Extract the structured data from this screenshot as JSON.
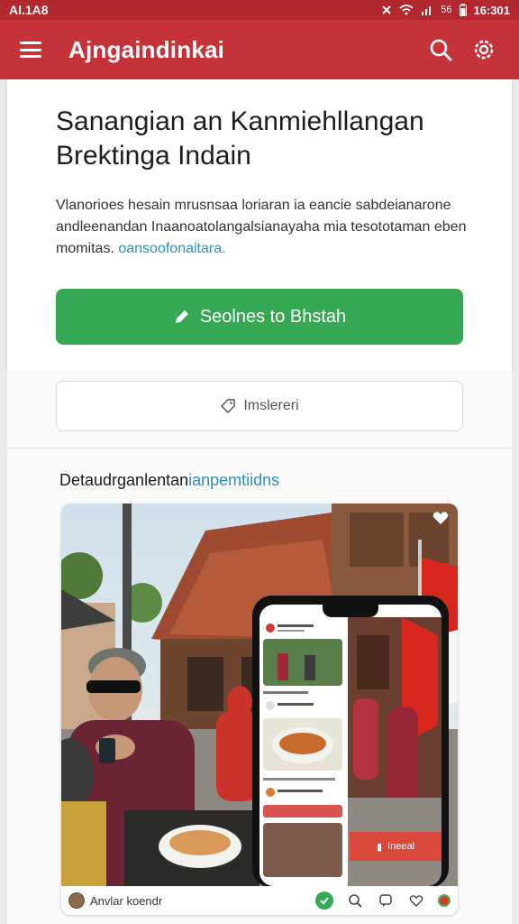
{
  "status_bar": {
    "left_text": "Al.1A8",
    "signal_text": "56",
    "time": "16:301"
  },
  "app_bar": {
    "title": "Ajngaindinkai",
    "icons": [
      "menu-icon",
      "search-icon",
      "gear-icon"
    ]
  },
  "hero": {
    "title_line1": "Sanangian an Kanmiehllangan",
    "title_line2": "Brektinga Indain",
    "description": "Vlanorioes hesain mrusnsaa loriaran ia eancie sabdeianarone andleenandan Inaanoatolangalsianayaha mia tesototaman eben momitas.",
    "description_link": "oansoofonaitara.",
    "primary_button": "Seolnes to Bhstah",
    "primary_button_icon": "pencil-icon",
    "primary_color": "#35a853"
  },
  "secondary_button": {
    "label": "Imslereri",
    "icon": "tag-icon"
  },
  "section": {
    "title_main": "Detaudrganlentan",
    "title_accent": "ianpemtiidns"
  },
  "photo_card": {
    "author": "Anvlar koendr",
    "footer_icons": [
      "check-icon",
      "search-icon",
      "comment-icon",
      "heart-icon",
      "record-icon"
    ],
    "phone_banner_text": "Ineeal"
  },
  "colors": {
    "brand_red": "#c5323a",
    "status_red": "#b3282e",
    "accent_blue": "#2e8fc6",
    "green": "#35a853"
  }
}
